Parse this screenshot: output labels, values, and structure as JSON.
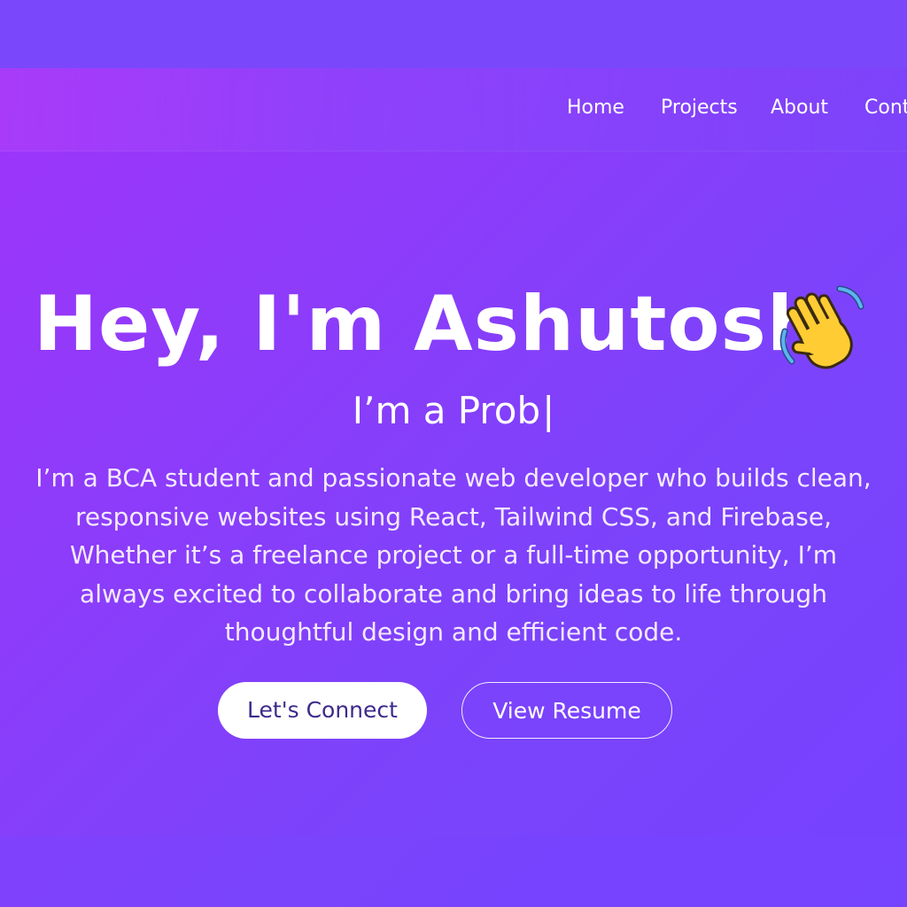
{
  "nav": {
    "items": [
      {
        "label": "Home"
      },
      {
        "label": "Projects"
      },
      {
        "label": "About"
      },
      {
        "label": "Contact"
      }
    ]
  },
  "hero": {
    "greeting": "Hey, I'm Ashutosh",
    "wave_icon": "waving-hand-icon",
    "typed_text": "I’m a Prob",
    "cursor": "|",
    "description": "I’m a BCA student and passionate web developer who builds clean, responsive websites using React, Tailwind CSS, and Firebase, Whether it’s a freelance project or a full-time opportunity, I’m always excited to collaborate and bring ideas to life through thoughtful design and efficient code.",
    "buttons": {
      "connect": "Let's Connect",
      "resume": "View Resume"
    }
  },
  "colors": {
    "gradient_start": "#a033fb",
    "gradient_end": "#7642ff",
    "primary_button_bg": "#ffffff",
    "primary_button_text": "#3d2a8c",
    "wave_yellow": "#ffcc33"
  }
}
